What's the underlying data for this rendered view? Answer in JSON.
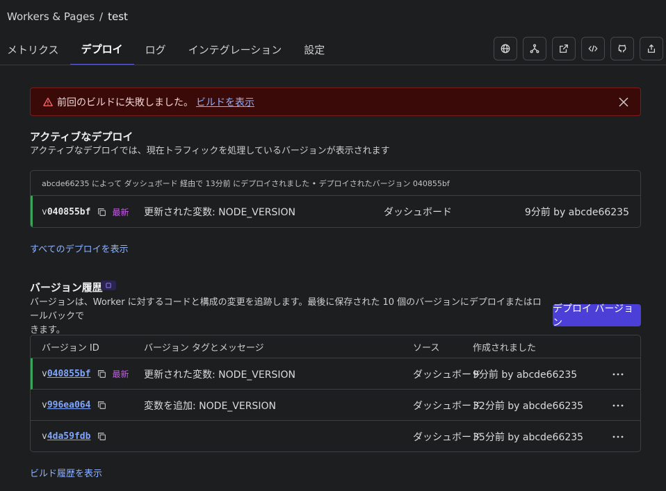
{
  "breadcrumb": {
    "parent": "Workers & Pages",
    "separator": "/",
    "current": "test"
  },
  "tabs": [
    {
      "label": "メトリクス",
      "active": false
    },
    {
      "label": "デプロイ",
      "active": true
    },
    {
      "label": "ログ",
      "active": false
    },
    {
      "label": "インテグレーション",
      "active": false
    },
    {
      "label": "設定",
      "active": false
    }
  ],
  "toolbar_icons": [
    "globe-icon",
    "branch-icon",
    "external-link-icon",
    "code-icon",
    "github-icon",
    "share-icon"
  ],
  "alert": {
    "message": "前回のビルドに失敗しました。",
    "link": "ビルドを表示"
  },
  "active_deploy": {
    "title": "アクティブなデプロイ",
    "description": "アクティブなデプロイでは、現在トラフィックを処理しているバージョンが表示されます",
    "summary": "abcde66235 によって ダッシュボード 経由で 13分前 にデプロイされました • デプロイされたバージョン 040855bf",
    "row": {
      "prefix": "v",
      "id": "040855bf",
      "badge": "最新",
      "message": "更新された変数: NODE_VERSION",
      "source": "ダッシュボード",
      "created": "9分前 by abcde66235"
    }
  },
  "show_all_deploys": "すべてのデプロイを表示",
  "version_history": {
    "title": "バージョン履歴",
    "description_line1": "バージョンは、Worker に対するコードと構成の変更を追跡します。最後に保存された 10 個のバージョンにデプロイまたはロールバックで",
    "description_line2": "きます。",
    "deploy_button": "デプロイ バージョン",
    "headers": {
      "id": "バージョン ID",
      "message": "バージョン タグとメッセージ",
      "source": "ソース",
      "created": "作成されました"
    },
    "rows": [
      {
        "prefix": "v",
        "id": "040855bf",
        "badge": "最新",
        "message": "更新された変数: NODE_VERSION",
        "source": "ダッシュボード",
        "created": "9分前 by abcde66235"
      },
      {
        "prefix": "v",
        "id": "996ea064",
        "badge": "",
        "message": "変数を追加: NODE_VERSION",
        "source": "ダッシュボード",
        "created": "32分前 by abcde66235"
      },
      {
        "prefix": "v",
        "id": "4da59fdb",
        "badge": "",
        "message": "",
        "source": "ダッシュボード",
        "created": "35分前 by abcde66235"
      }
    ]
  },
  "show_build_history": "ビルド履歴を表示",
  "colors": {
    "accent": "#4b3fd8",
    "link": "#8fb2ff",
    "badge": "#c65ce8",
    "current_marker": "#3aa55a",
    "alert_bg": "#3a0a09"
  }
}
